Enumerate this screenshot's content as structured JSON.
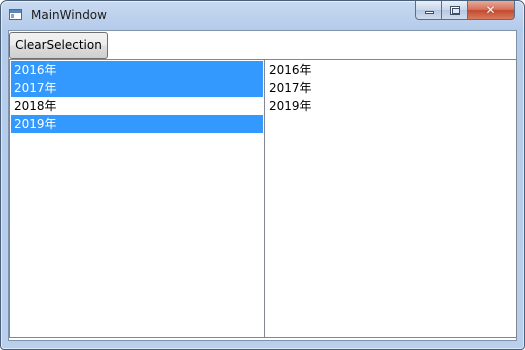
{
  "window": {
    "title": "MainWindow",
    "close_glyph": "✕"
  },
  "toolbar": {
    "clear_selection_label": "ClearSelection"
  },
  "left_list": {
    "items": [
      {
        "label": "2016年",
        "selected": true
      },
      {
        "label": "2017年",
        "selected": true
      },
      {
        "label": "2018年",
        "selected": false
      },
      {
        "label": "2019年",
        "selected": true
      }
    ]
  },
  "right_list": {
    "items": [
      {
        "label": "2016年"
      },
      {
        "label": "2017年"
      },
      {
        "label": "2019年"
      }
    ]
  },
  "colors": {
    "selection": "#3399ff",
    "selection_text": "#ffffff",
    "close_button": "#c94a30"
  }
}
